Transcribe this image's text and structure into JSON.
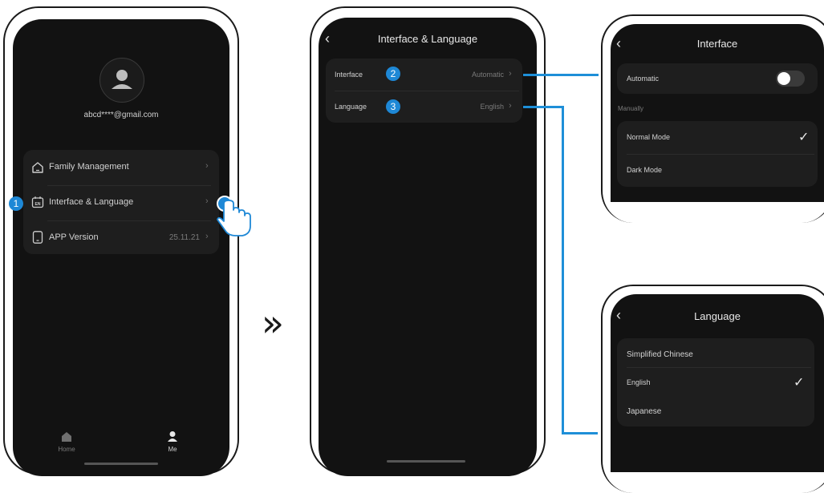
{
  "phone1": {
    "email": "abcd****@gmail.com",
    "menu": [
      {
        "label": "Family Management",
        "value": ""
      },
      {
        "label": "Interface & Language",
        "value": ""
      },
      {
        "label": "APP Version",
        "value": "25.11.21"
      }
    ],
    "lang_icon_text": "EN",
    "step_badge": "1",
    "tabs": [
      {
        "label": "Home"
      },
      {
        "label": "Me"
      }
    ]
  },
  "arrow_glyph": "»",
  "phone2": {
    "title": "Interface & Language",
    "rows": [
      {
        "label": "Interface",
        "badge": "2",
        "value": "Automatic"
      },
      {
        "label": "Language",
        "badge": "3",
        "value": "English"
      }
    ]
  },
  "interface_screen": {
    "title": "Interface",
    "automatic_label": "Automatic",
    "automatic_enabled": false,
    "section_label": "Manually",
    "options": [
      {
        "label": "Normal Mode",
        "selected": true
      },
      {
        "label": "Dark Mode",
        "selected": false
      }
    ]
  },
  "language_screen": {
    "title": "Language",
    "options": [
      {
        "label": "Simplified Chinese",
        "selected": false
      },
      {
        "label": "English",
        "selected": true
      },
      {
        "label": "Japanese",
        "selected": false
      }
    ]
  },
  "colors": {
    "accent": "#1e88d6",
    "screen_bg": "#121212",
    "card_bg": "#1e1e1e"
  },
  "icons": [
    "avatar-icon",
    "house-icon",
    "language-icon",
    "phone-icon",
    "chevron-right-icon",
    "back-icon",
    "tap-hand-icon",
    "checkmark-icon",
    "home-tab-icon",
    "me-tab-icon"
  ]
}
